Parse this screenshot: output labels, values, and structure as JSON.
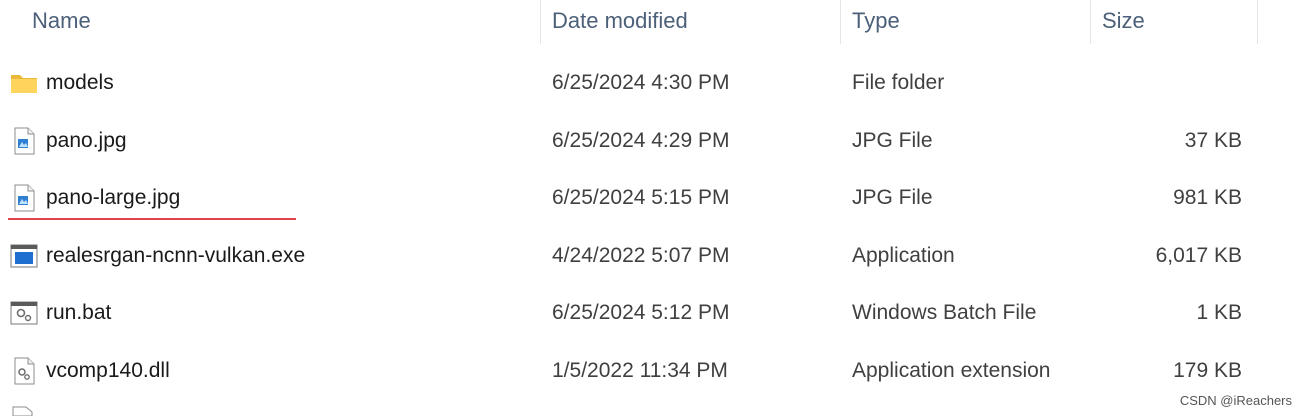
{
  "columns": {
    "name": "Name",
    "date": "Date modified",
    "type": "Type",
    "size": "Size"
  },
  "files": [
    {
      "name": "models",
      "date": "6/25/2024 4:30 PM",
      "type": "File folder",
      "size": "",
      "icon": "folder-icon"
    },
    {
      "name": "pano.jpg",
      "date": "6/25/2024 4:29 PM",
      "type": "JPG File",
      "size": "37 KB",
      "icon": "image-file-icon"
    },
    {
      "name": "pano-large.jpg",
      "date": "6/25/2024 5:15 PM",
      "type": "JPG File",
      "size": "981 KB",
      "icon": "image-file-icon",
      "highlighted": true
    },
    {
      "name": "realesrgan-ncnn-vulkan.exe",
      "date": "4/24/2022 5:07 PM",
      "type": "Application",
      "size": "6,017 KB",
      "icon": "application-icon"
    },
    {
      "name": "run.bat",
      "date": "6/25/2024 5:12 PM",
      "type": "Windows Batch File",
      "size": "1 KB",
      "icon": "batch-file-icon"
    },
    {
      "name": "vcomp140.dll",
      "date": "1/5/2022 11:34 PM",
      "type": "Application extension",
      "size": "179 KB",
      "icon": "dll-file-icon"
    }
  ],
  "annotation": {
    "underline_color": "#e3424a"
  },
  "watermark": "CSDN @iReachers"
}
